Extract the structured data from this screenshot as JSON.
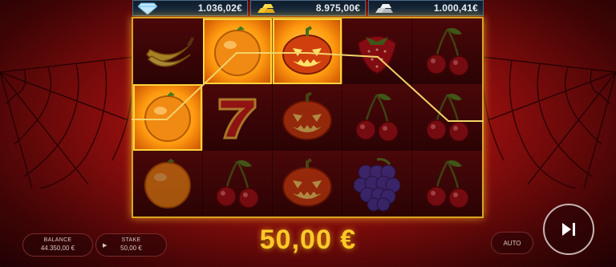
{
  "jackpots": [
    {
      "icon": "diamond-icon",
      "value": "1.036,02€"
    },
    {
      "icon": "gold-bars-icon",
      "value": "8.975,00€"
    },
    {
      "icon": "silver-bars-icon",
      "value": "1.000,41€"
    }
  ],
  "reels": [
    [
      "banana",
      "orange",
      "pumpkin",
      "strawberry",
      "cherries"
    ],
    [
      "orange",
      "seven",
      "pumpkin",
      "cherries",
      "cherries"
    ],
    [
      "orange",
      "cherries",
      "pumpkin",
      "grapes",
      "cherries"
    ]
  ],
  "winning_cells": [
    [
      0,
      1
    ],
    [
      0,
      2
    ],
    [
      1,
      0
    ]
  ],
  "win_amount": "50,00 €",
  "balance": {
    "label": "BALANCE",
    "value": "44.350,00 €"
  },
  "stake": {
    "label": "STAKE",
    "value": "50,00 €"
  },
  "auto_label": "AUTO",
  "colors": {
    "accent": "#ffc82a",
    "frame": "#d9a520",
    "background": "#8a0d0d"
  }
}
